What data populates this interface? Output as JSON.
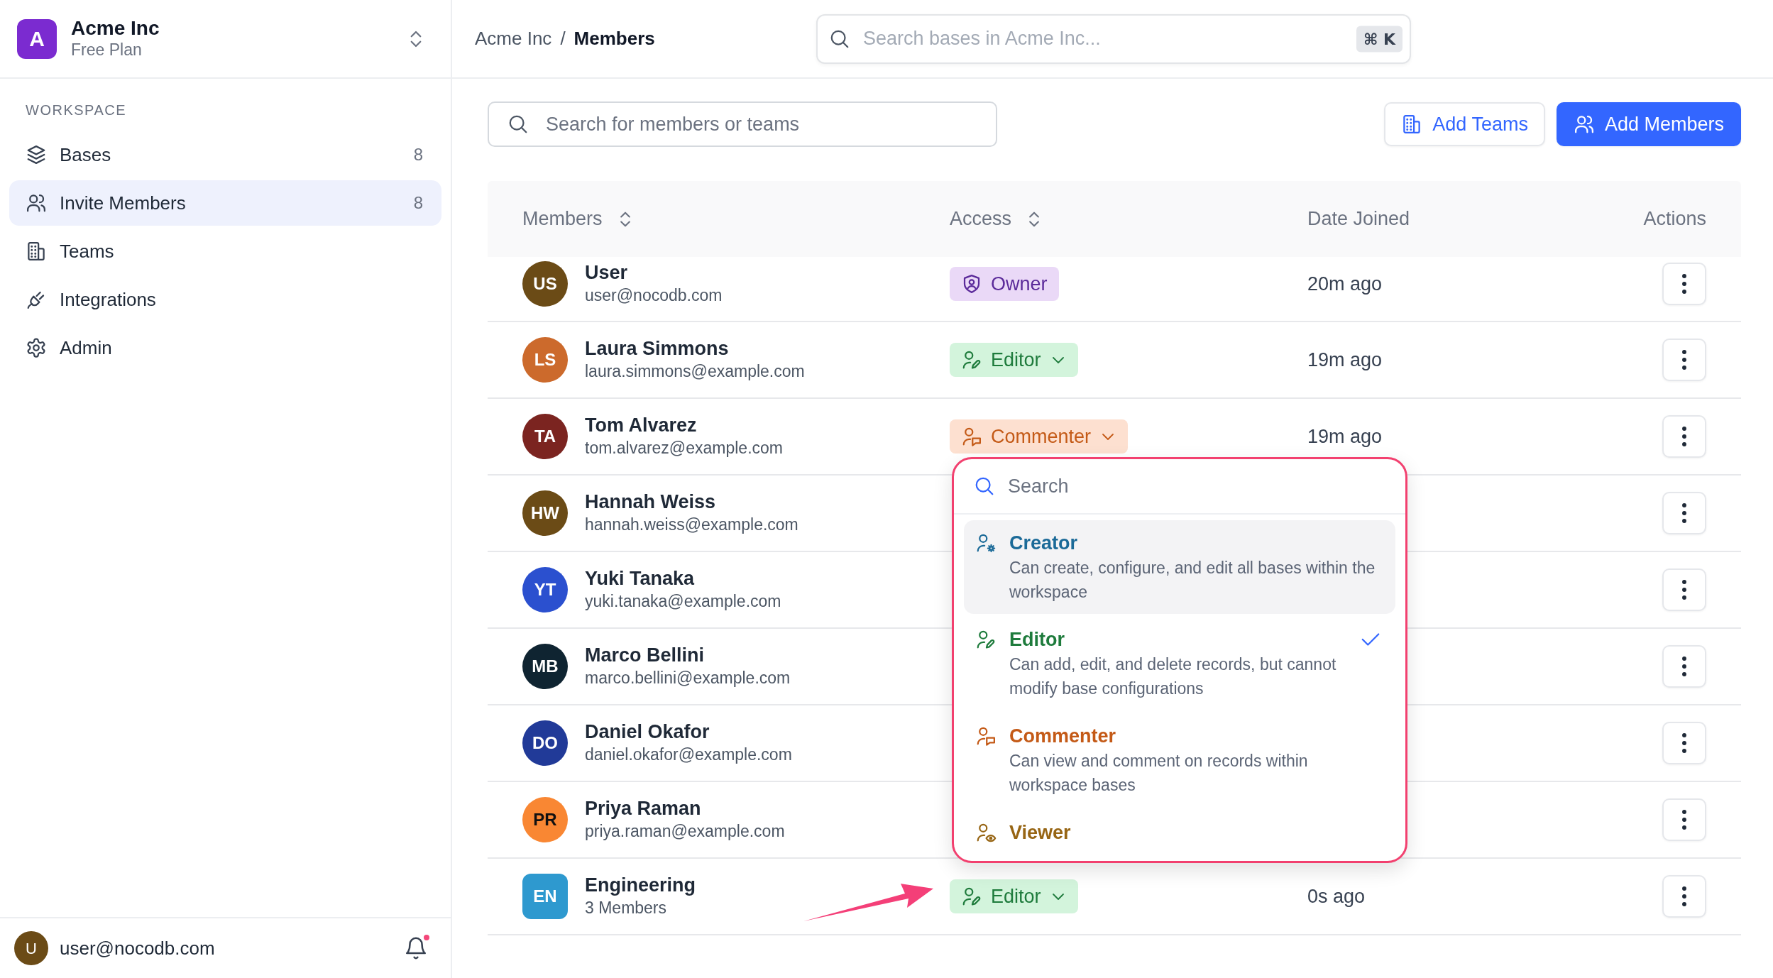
{
  "workspace": {
    "logo_letter": "A",
    "name": "Acme Inc",
    "plan": "Free Plan"
  },
  "sidebar": {
    "section_label": "WORKSPACE",
    "items": [
      {
        "label": "Bases",
        "count": "8",
        "selected": false
      },
      {
        "label": "Invite Members",
        "count": "8",
        "selected": true
      },
      {
        "label": "Teams",
        "selected": false
      },
      {
        "label": "Integrations",
        "selected": false
      },
      {
        "label": "Admin",
        "selected": false
      }
    ]
  },
  "account": {
    "initial": "U",
    "email": "user@nocodb.com",
    "has_unread": true
  },
  "breadcrumb": {
    "items": [
      "Acme Inc",
      "Members"
    ],
    "separator": "/"
  },
  "global_search": {
    "placeholder": "Search bases in Acme Inc...",
    "shortcut": "⌘ K"
  },
  "toolbar": {
    "search_placeholder": "Search for members or teams",
    "buttons": [
      {
        "label": "Add Teams",
        "kind": "secondary"
      },
      {
        "label": "Add Members",
        "kind": "primary"
      }
    ]
  },
  "table": {
    "columns": [
      {
        "label": "Members",
        "sortable": true
      },
      {
        "label": "Access",
        "sortable": true
      },
      {
        "label": "Date Joined",
        "sortable": false
      },
      {
        "label": "Actions",
        "sortable": false
      }
    ],
    "rows": [
      {
        "kind": "user",
        "initials": "US",
        "color": "#6b4b16",
        "name": "User",
        "detail": "user@nocodb.com",
        "access": {
          "kind": "owner",
          "label": "Owner",
          "has_menu": false
        },
        "joined": "20m ago"
      },
      {
        "kind": "user",
        "initials": "LS",
        "color": "#cc6a2c",
        "name": "Laura Simmons",
        "detail": "laura.simmons@example.com",
        "access": {
          "kind": "editor",
          "label": "Editor",
          "has_menu": true
        },
        "joined": "19m ago"
      },
      {
        "kind": "user",
        "initials": "TA",
        "color": "#7b2420",
        "name": "Tom Alvarez",
        "detail": "tom.alvarez@example.com",
        "access": {
          "kind": "commenter",
          "label": "Commenter",
          "has_menu": true
        },
        "joined": "19m ago"
      },
      {
        "kind": "user",
        "initials": "HW",
        "color": "#6b4b16",
        "name": "Hannah Weiss",
        "detail": "hannah.weiss@example.com"
      },
      {
        "kind": "user",
        "initials": "YT",
        "color": "#2b50cf",
        "name": "Yuki Tanaka",
        "detail": "yuki.tanaka@example.com"
      },
      {
        "kind": "user",
        "initials": "MB",
        "color": "#0f2431",
        "name": "Marco Bellini",
        "detail": "marco.bellini@example.com"
      },
      {
        "kind": "user",
        "initials": "DO",
        "color": "#213a98",
        "name": "Daniel Okafor",
        "detail": "daniel.okafor@example.com"
      },
      {
        "kind": "user",
        "initials": "PR",
        "color": "#f98733",
        "name": "Priya Raman",
        "detail": "priya.raman@example.com"
      },
      {
        "kind": "team",
        "initials": "EN",
        "color": "#2e99cf",
        "name": "Engineering",
        "detail": "3 Members",
        "access": {
          "kind": "editor",
          "label": "Editor",
          "has_menu": true
        },
        "joined": "0s ago"
      }
    ]
  },
  "role_menu": {
    "search_placeholder": "Search",
    "options": [
      {
        "kind": "creator",
        "title": "Creator",
        "description": "Can create, configure, and edit all bases within the workspace",
        "selected": false,
        "highlighted": true
      },
      {
        "kind": "editor",
        "title": "Editor",
        "description": "Can add, edit, and delete records, but cannot modify base configurations",
        "selected": true,
        "highlighted": false
      },
      {
        "kind": "commenter",
        "title": "Commenter",
        "description": "Can view and comment on records within workspace bases",
        "selected": false,
        "highlighted": false
      },
      {
        "kind": "viewer",
        "title": "Viewer",
        "selected": false,
        "highlighted": false
      }
    ]
  }
}
